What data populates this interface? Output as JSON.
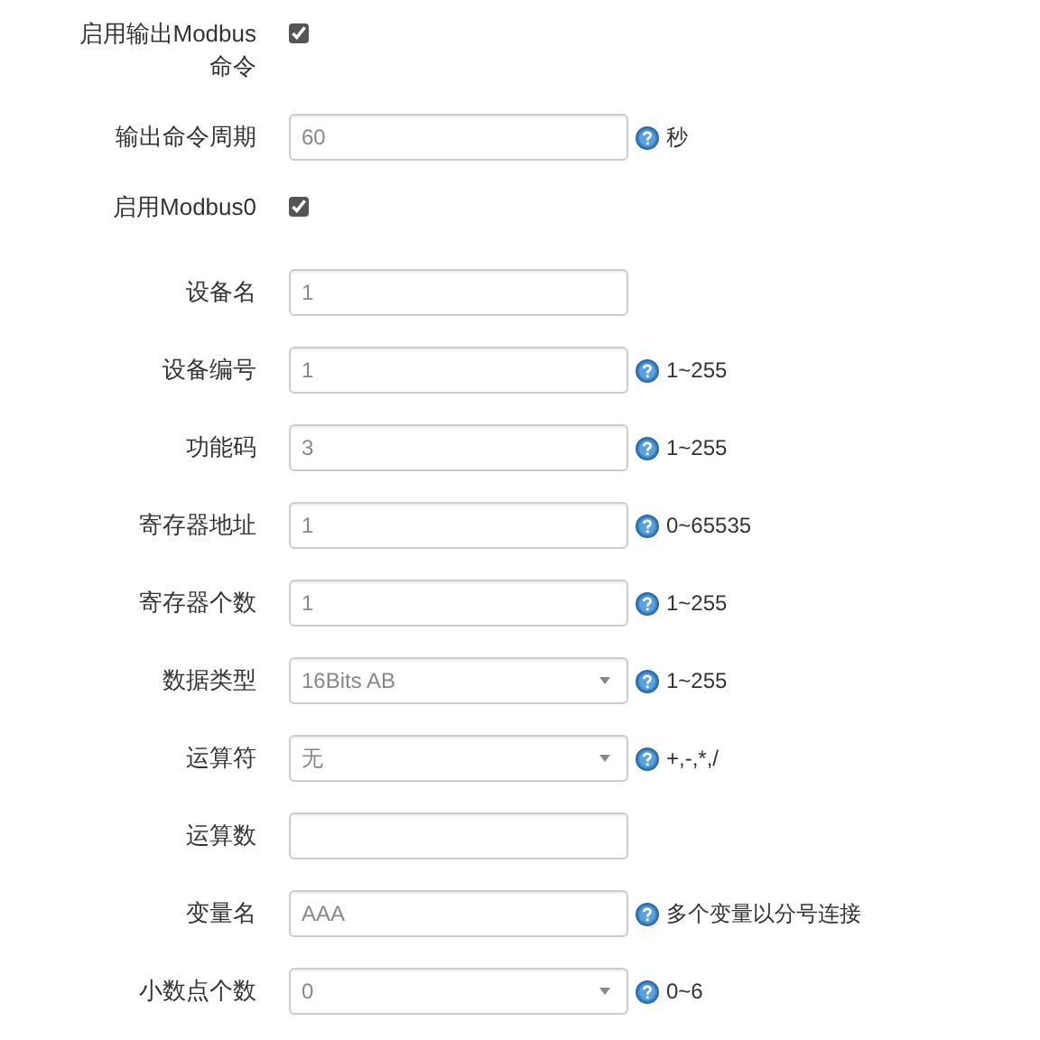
{
  "fields": [
    {
      "kind": "checkbox",
      "label": "启用输出Modbus命令",
      "checked": true
    },
    {
      "kind": "input",
      "label": "输出命令周期",
      "value": "60",
      "hint": "秒"
    },
    {
      "kind": "checkbox",
      "label": "启用Modbus0",
      "checked": true
    },
    {
      "kind": "input",
      "label": "设备名",
      "value": "1"
    },
    {
      "kind": "input",
      "label": "设备编号",
      "value": "1",
      "hint": "1~255"
    },
    {
      "kind": "input",
      "label": "功能码",
      "value": "3",
      "hint": "1~255"
    },
    {
      "kind": "input",
      "label": "寄存器地址",
      "value": "1",
      "hint": "0~65535"
    },
    {
      "kind": "input",
      "label": "寄存器个数",
      "value": "1",
      "hint": "1~255"
    },
    {
      "kind": "select",
      "label": "数据类型",
      "value": "16Bits AB",
      "hint": "1~255"
    },
    {
      "kind": "select",
      "label": "运算符",
      "value": "无",
      "hint": "+,-,*,/"
    },
    {
      "kind": "input",
      "label": "运算数"
    },
    {
      "kind": "input",
      "label": "变量名",
      "value": "AAA",
      "hint": "多个变量以分号连接"
    },
    {
      "kind": "select",
      "label": "小数点个数",
      "value": "0",
      "hint": "0~6"
    }
  ]
}
